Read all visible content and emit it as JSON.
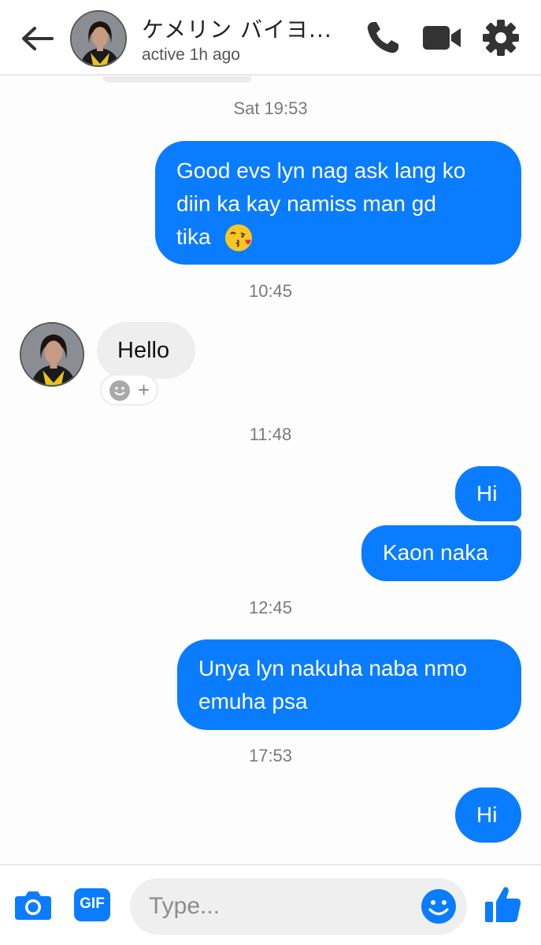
{
  "header": {
    "contact_name": "ケメリン バイヨ...",
    "status": "active 1h ago"
  },
  "icons": {
    "back": "arrow-left-icon",
    "call": "phone-icon",
    "video": "video-camera-icon",
    "settings": "gear-icon",
    "camera": "camera-icon",
    "gif": "gif-icon",
    "emoji": "smiley-icon",
    "like": "thumbs-up-icon"
  },
  "colors": {
    "accent": "#0a7cff",
    "incoming_bubble": "#eeeeee",
    "timestamp": "#7a7a7a"
  },
  "timestamps": [
    "Sat 19:53",
    "10:45",
    "11:48",
    "12:45",
    "17:53"
  ],
  "messages": {
    "m1_line1": "Good evs lyn nag ask lang ko",
    "m1_line2": "diin ka kay namiss man gd",
    "m1_line3": "tika",
    "m2": "Hello",
    "m3": "Hi",
    "m4": "Kaon naka",
    "m5_line1": "Unya lyn nakuha naba nmo",
    "m5_line2": "emuha psa",
    "m6": "Hi"
  },
  "reaction": {
    "add_symbol": "+"
  },
  "composer": {
    "placeholder": "Type...",
    "gif_label": "GIF"
  }
}
